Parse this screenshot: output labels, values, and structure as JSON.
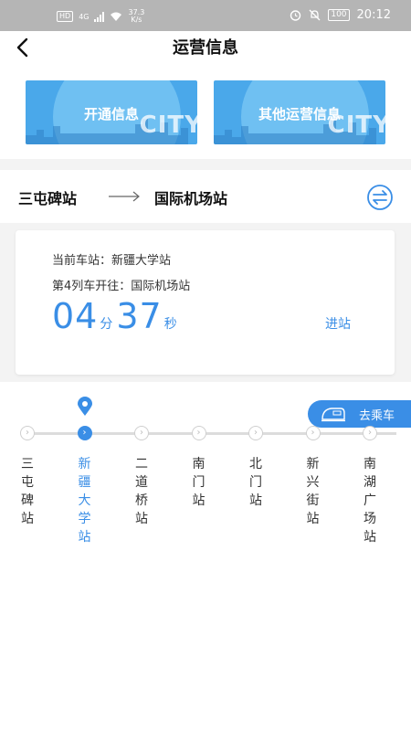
{
  "status_bar": {
    "hd": "HD",
    "network": "4G",
    "speed_value": "37.3",
    "speed_unit": "K/s",
    "battery": "100",
    "time": "20:12"
  },
  "header": {
    "title": "运营信息",
    "back_icon": "back-arrow-icon"
  },
  "banners": [
    {
      "label": "开通信息",
      "watermark": "CITY"
    },
    {
      "label": "其他运营信息",
      "watermark": "CITY"
    }
  ],
  "route": {
    "from": "三屯碑站",
    "to": "国际机场站",
    "swap_icon": "swap-direction-icon"
  },
  "train_info": {
    "current_station_text": "当前车站：新疆大学站",
    "heading_text": "第4列车开往：国际机场站",
    "minutes": "04",
    "minutes_unit": "分",
    "seconds": "37",
    "seconds_unit": "秒",
    "status": "进站"
  },
  "go_ride": {
    "label": "去乘车",
    "icon": "train-icon"
  },
  "colors": {
    "accent": "#3a8ee6",
    "status_bar": "#b5b5b5",
    "section_bg": "#f3f3f3"
  },
  "line": {
    "current_index": 1,
    "stations": [
      {
        "name": "三屯碑站"
      },
      {
        "name": "新疆大学站"
      },
      {
        "name": "二道桥站"
      },
      {
        "name": "南门站"
      },
      {
        "name": "北门站"
      },
      {
        "name": "新兴街站"
      },
      {
        "name": "南湖广场站"
      }
    ]
  }
}
